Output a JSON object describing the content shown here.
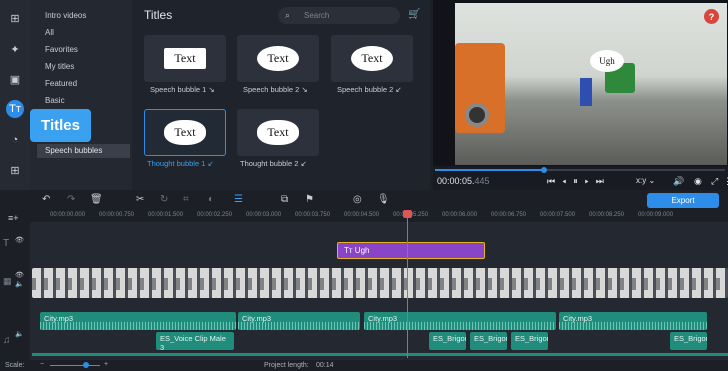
{
  "categories": {
    "items": [
      "Intro videos",
      "All",
      "Favorites",
      "My titles",
      "Featured",
      "Basic",
      "Speech bubbles"
    ],
    "tooltip": "Titles"
  },
  "titles_panel": {
    "heading": "Titles",
    "search_placeholder": "Search",
    "tiles": [
      {
        "label": "Speech bubble 1 ↘",
        "bubble": "Text"
      },
      {
        "label": "Speech bubble 2 ↘",
        "bubble": "Text"
      },
      {
        "label": "Speech bubble 2 ↙",
        "bubble": "Text"
      },
      {
        "label": "Thought bubble 1 ↙",
        "bubble": "Text"
      },
      {
        "label": "Thought bubble 2 ↙",
        "bubble": "Text"
      }
    ]
  },
  "preview": {
    "bubble_text": "Ugh",
    "help": "?",
    "time_main": "00:00:05.",
    "time_ms": "445",
    "aspect": "x:y"
  },
  "toolbar": {
    "export_label": "Export"
  },
  "ruler": {
    "ticks": [
      "00:00:00.000",
      "00:00:00.750",
      "00:00:01.500",
      "00:00:02.250",
      "00:00:03.000",
      "00:00:03.750",
      "00:00:04.500",
      "00:00:05.250",
      "00:00:06.000",
      "00:00:06.750",
      "00:00:07.500",
      "00:00:08.250",
      "00:00:09.000"
    ]
  },
  "timeline": {
    "title_clip": "Ugh",
    "audio1": [
      "City.mp3",
      "City.mp3",
      "City.mp3",
      "City.mp3"
    ],
    "audio2": [
      "ES_Voice Clip Male 3",
      "ES_Brigor",
      "ES_Brigor",
      "ES_Brigor",
      "ES_Brigor"
    ]
  },
  "status": {
    "scale_label": "Scale:",
    "project_length_label": "Project length:",
    "project_length": "00:14"
  },
  "colors": {
    "accent": "#2c8ee8",
    "title_clip": "#8a44c8",
    "audio_clip": "#1f8c7c",
    "playhead": "#e05555"
  }
}
